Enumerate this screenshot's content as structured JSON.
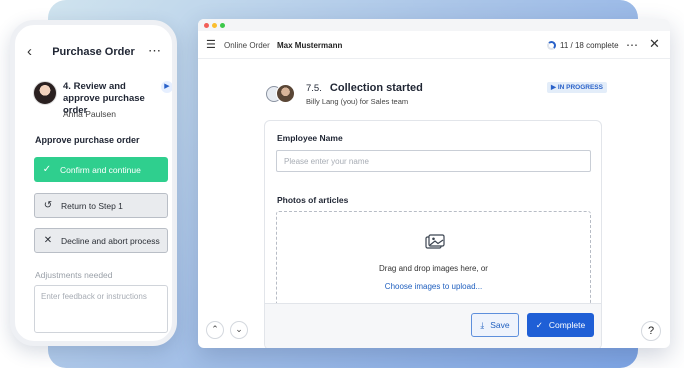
{
  "phone": {
    "back_icon": "chevron-left-icon",
    "title": "Purchase Order",
    "more_icon": "more-horizontal-icon",
    "step": {
      "number": "4.",
      "title": "Review and approve purchase order",
      "assignee": "Anna Paulsen",
      "play_icon": "play-icon"
    },
    "approve_label": "Approve purchase order",
    "actions": {
      "confirm": {
        "icon": "check-icon",
        "label": "Confirm and continue",
        "color": "#2fcf8e"
      },
      "return": {
        "icon": "undo-icon",
        "label": "Return to Step 1"
      },
      "decline": {
        "icon": "close-icon",
        "label": "Decline and abort process"
      }
    },
    "adjustments_label": "Adjustments needed",
    "feedback_placeholder": "Enter feedback or instructions"
  },
  "window": {
    "toolbar": {
      "menu_icon": "hamburger-icon",
      "breadcrumb_primary": "Online Order",
      "breadcrumb_secondary": "Max Mustermann",
      "progress_completed": 11,
      "progress_total": 18,
      "progress_text": "11 / 18 complete",
      "more_icon": "more-horizontal-icon",
      "close_icon": "close-icon"
    },
    "task": {
      "number": "7.5.",
      "title": "Collection started",
      "subtitle": "Billy Lang (you) for Sales team",
      "status": "IN PROGRESS",
      "status_color": "#2a62c9"
    },
    "form": {
      "employee_label": "Employee Name",
      "employee_placeholder": "Please enter your name",
      "photos_label": "Photos of articles",
      "drop_text": "Drag and drop images here, or",
      "choose_link": "Choose images to upload..."
    },
    "footer": {
      "save_label": "Save",
      "complete_label": "Complete",
      "accent_color": "#1f5fd6"
    },
    "nav": {
      "up_icon": "chevron-up-icon",
      "down_icon": "chevron-down-icon",
      "help": "?"
    }
  }
}
